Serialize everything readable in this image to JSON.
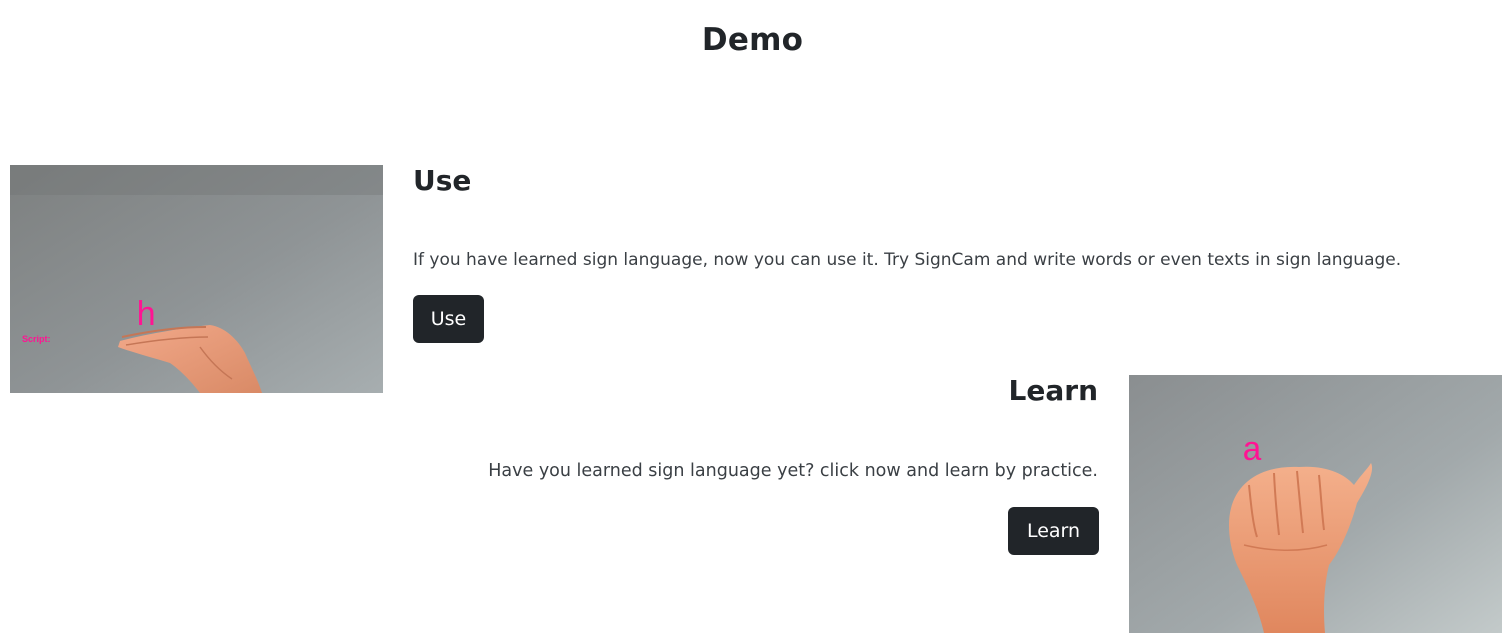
{
  "page": {
    "title": "Demo"
  },
  "use_section": {
    "heading": "Use",
    "description": "If you have learned sign language, now you can use it. Try SignCam and write words or even texts in sign language.",
    "button_label": "Use",
    "image": {
      "letter": "h",
      "script_label": "Script:"
    }
  },
  "learn_section": {
    "heading": "Learn",
    "description": "Have you learned sign language yet? click now and learn by practice.",
    "button_label": "Learn",
    "image": {
      "letter": "a"
    }
  },
  "colors": {
    "button_bg": "#212529",
    "overlay_magenta": "#ff1493"
  }
}
